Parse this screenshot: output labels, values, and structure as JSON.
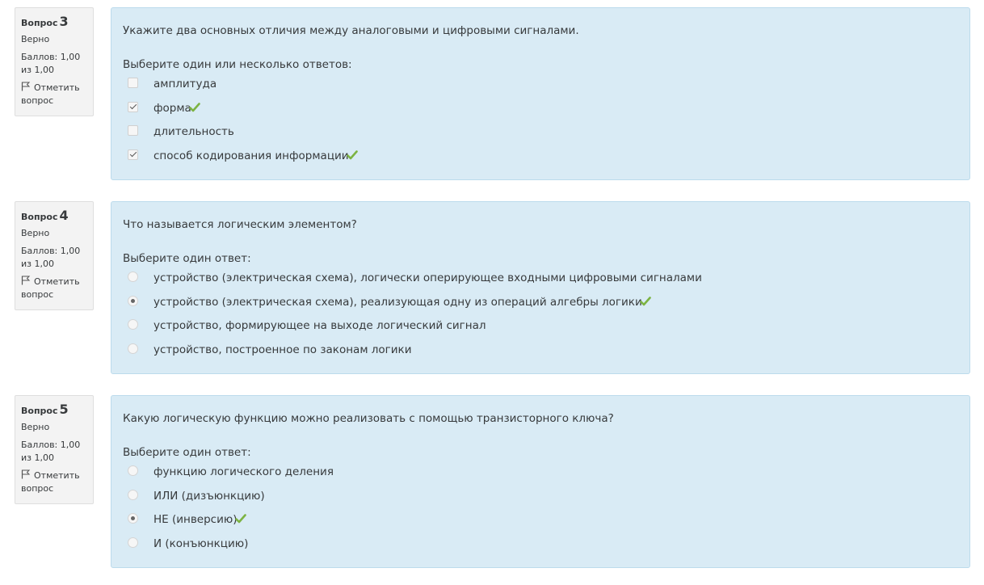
{
  "labels": {
    "question": "Вопрос",
    "flag": "Отметить вопрос"
  },
  "accent": {
    "correct": "#7cb342",
    "panel": "#d9ebf5",
    "info": "#f3f3f3"
  },
  "questions": [
    {
      "number": "3",
      "state": "Верно",
      "grade": "Баллов: 1,00 из 1,00",
      "text": "Укажите два основных отличия между аналоговыми и цифровыми сигналами.",
      "prompt": "Выберите один или несколько ответов:",
      "type": "checkbox",
      "answers": [
        {
          "label": "амплитуда",
          "checked": false,
          "correct": false
        },
        {
          "label": "форма",
          "checked": true,
          "correct": true
        },
        {
          "label": "длительность",
          "checked": false,
          "correct": false
        },
        {
          "label": "способ кодирования информации",
          "checked": true,
          "correct": true
        }
      ]
    },
    {
      "number": "4",
      "state": "Верно",
      "grade": "Баллов: 1,00 из 1,00",
      "text": "Что называется логическим элементом?",
      "prompt": "Выберите один ответ:",
      "type": "radio",
      "answers": [
        {
          "label": "устройство (электрическая схема), логически оперирующее входными цифровыми сигналами",
          "checked": false,
          "correct": false
        },
        {
          "label": "устройство (электрическая схема), реализующая одну из операций алгебры логики",
          "checked": true,
          "correct": true
        },
        {
          "label": "устройство, формирующее на выходе логический сигнал",
          "checked": false,
          "correct": false
        },
        {
          "label": "устройство, построенное по законам логики",
          "checked": false,
          "correct": false
        }
      ]
    },
    {
      "number": "5",
      "state": "Верно",
      "grade": "Баллов: 1,00 из 1,00",
      "text": "Какую логическую функцию можно реализовать с помощью транзисторного ключа?",
      "prompt": "Выберите один ответ:",
      "type": "radio",
      "answers": [
        {
          "label": "функцию логического деления",
          "checked": false,
          "correct": false
        },
        {
          "label": "ИЛИ (дизъюнкцию)",
          "checked": false,
          "correct": false
        },
        {
          "label": "НЕ (инверсию)",
          "checked": true,
          "correct": true
        },
        {
          "label": "И (конъюнкцию)",
          "checked": false,
          "correct": false
        }
      ]
    }
  ]
}
